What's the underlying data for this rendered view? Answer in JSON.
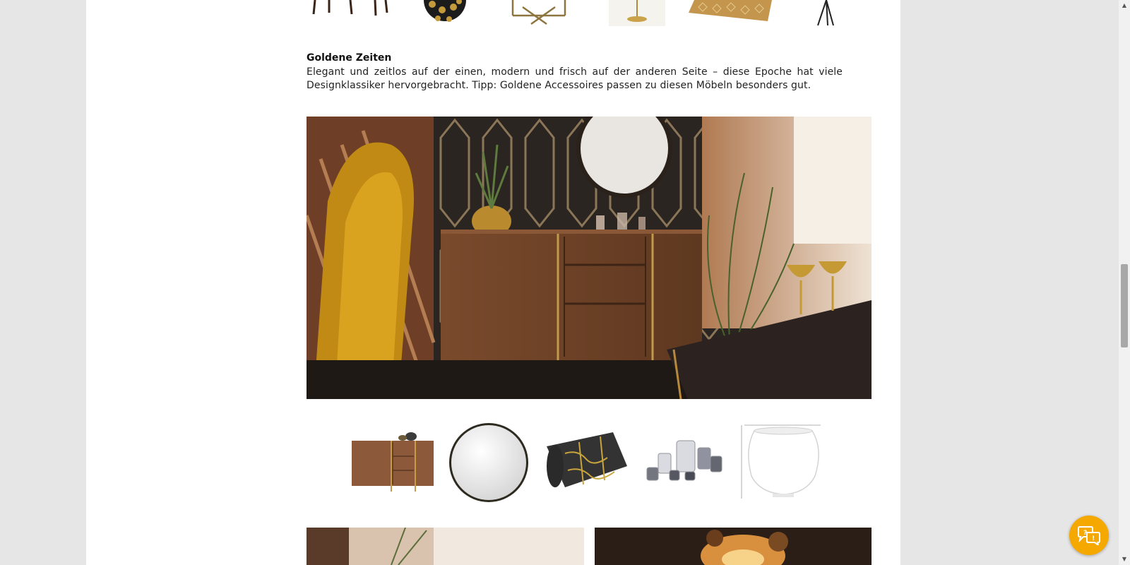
{
  "section": {
    "title": "Goldene Zeiten",
    "text": "Elegant und zeitlos auf der einen, modern und frisch auf der anderen Seite – diese Epoche hat viele Designklassiker hervorgebracht. Tipp: Goldene Accessoires passen zu diesen Möbeln besonders gut."
  },
  "top_products": [
    {
      "icon": "chair-legs-product"
    },
    {
      "icon": "pendant-lamp-product"
    },
    {
      "icon": "side-table-product"
    },
    {
      "icon": "table-lamp-product"
    },
    {
      "icon": "rug-product"
    },
    {
      "icon": "floor-lamp-product"
    }
  ],
  "hero": {
    "icon": "living-room-sideboard-photo"
  },
  "products": [
    {
      "icon": "sideboard-product"
    },
    {
      "icon": "round-mirror-product"
    },
    {
      "icon": "wallpaper-roll-product"
    },
    {
      "icon": "candle-holders-product"
    },
    {
      "icon": "white-vase-product"
    }
  ],
  "colors": {
    "accent": "#f5a800",
    "background": "#e6e6e6",
    "panel": "#ffffff"
  },
  "help_button": {
    "icon": "chat-help-icon"
  }
}
